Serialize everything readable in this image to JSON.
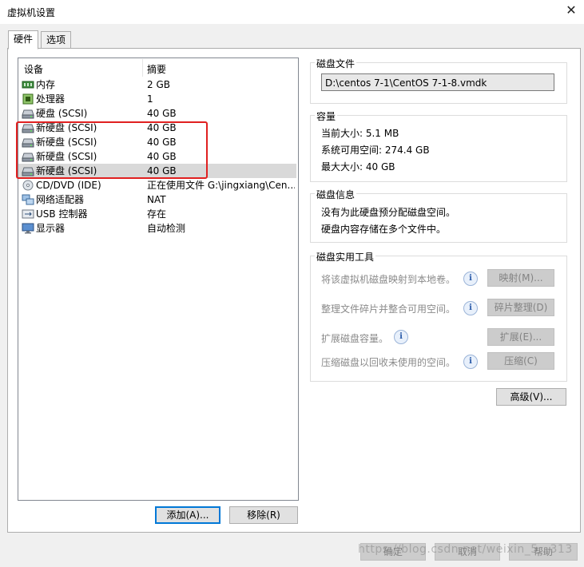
{
  "window": {
    "title": "虚拟机设置",
    "close_glyph": "✕"
  },
  "tabs": [
    {
      "label": "硬件"
    },
    {
      "label": "选项"
    }
  ],
  "device_list": {
    "columns": {
      "device": "设备",
      "summary": "摘要"
    },
    "rows": [
      {
        "icon": "memory-icon",
        "name": "内存",
        "summary": "2 GB"
      },
      {
        "icon": "cpu-icon",
        "name": "处理器",
        "summary": "1"
      },
      {
        "icon": "hard-disk-icon",
        "name": "硬盘 (SCSI)",
        "summary": "40 GB"
      },
      {
        "icon": "hard-disk-icon",
        "name": "新硬盘 (SCSI)",
        "summary": "40 GB"
      },
      {
        "icon": "hard-disk-icon",
        "name": "新硬盘 (SCSI)",
        "summary": "40 GB"
      },
      {
        "icon": "hard-disk-icon",
        "name": "新硬盘 (SCSI)",
        "summary": "40 GB"
      },
      {
        "icon": "hard-disk-icon",
        "name": "新硬盘 (SCSI)",
        "summary": "40 GB",
        "selected": true
      },
      {
        "icon": "cd-dvd-icon",
        "name": "CD/DVD (IDE)",
        "summary": "正在使用文件 G:\\jingxiang\\Cen..."
      },
      {
        "icon": "network-adapter-icon",
        "name": "网络适配器",
        "summary": "NAT"
      },
      {
        "icon": "usb-icon",
        "name": "USB 控制器",
        "summary": "存在"
      },
      {
        "icon": "display-icon",
        "name": "显示器",
        "summary": "自动检测"
      }
    ]
  },
  "list_buttons": {
    "add": "添加(A)...",
    "remove": "移除(R)"
  },
  "disk_file": {
    "title": "磁盘文件",
    "path": "D:\\centos 7-1\\CentOS 7-1-8.vmdk"
  },
  "capacity": {
    "title": "容量",
    "current_size": "当前大小: 5.1 MB",
    "free_space": "系统可用空间: 274.4 GB",
    "max_size": "最大大小: 40 GB"
  },
  "disk_info": {
    "title": "磁盘信息",
    "line1": "没有为此硬盘预分配磁盘空间。",
    "line2": "硬盘内容存储在多个文件中。"
  },
  "disk_utilities": {
    "title": "磁盘实用工具",
    "map": {
      "text": "将该虚拟机磁盘映射到本地卷。",
      "button": "映射(M)..."
    },
    "defrag": {
      "text": "整理文件碎片并整合可用空间。",
      "button": "碎片整理(D)"
    },
    "expand": {
      "text": "扩展磁盘容量。",
      "button": "扩展(E)..."
    },
    "compact": {
      "text": "压缩磁盘以回收未使用的空间。",
      "button": "压缩(C)"
    }
  },
  "advanced_button": "高级(V)...",
  "footer": {
    "ok": "确定",
    "cancel": "取消",
    "help": "帮助"
  },
  "watermark": "https://blog.csdn.net/weixin_5...313",
  "colors": {
    "highlight_border": "#e02020",
    "selection": "#d9d9d9",
    "focus": "#0078d7"
  }
}
